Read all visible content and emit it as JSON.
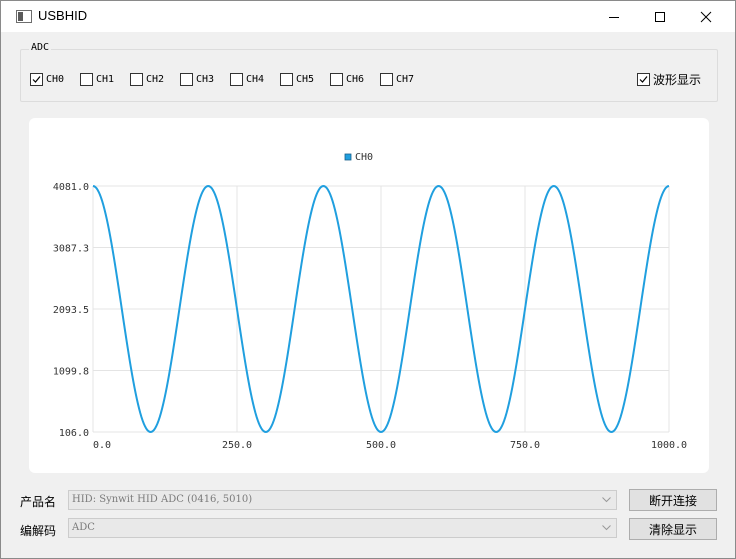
{
  "window": {
    "title": "USBHID"
  },
  "adc_group": {
    "label": "ADC",
    "channels": [
      {
        "label": "CH0",
        "checked": true
      },
      {
        "label": "CH1",
        "checked": false
      },
      {
        "label": "CH2",
        "checked": false
      },
      {
        "label": "CH3",
        "checked": false
      },
      {
        "label": "CH4",
        "checked": false
      },
      {
        "label": "CH5",
        "checked": false
      },
      {
        "label": "CH6",
        "checked": false
      },
      {
        "label": "CH7",
        "checked": false
      }
    ],
    "show_waveform": {
      "label": "波形显示",
      "checked": true
    }
  },
  "chart_data": {
    "type": "line",
    "title": "",
    "xlabel": "",
    "ylabel": "",
    "xlim": [
      0,
      1000
    ],
    "ylim": [
      106.0,
      4081.0
    ],
    "x_ticks": [
      "0.0",
      "250.0",
      "500.0",
      "750.0",
      "1000.0"
    ],
    "y_ticks": [
      "4081.0",
      "3087.3",
      "2093.5",
      "1099.8",
      "106.0"
    ],
    "grid": true,
    "legend_position": "top-center",
    "series": [
      {
        "name": "CH0",
        "color": "#209fdf",
        "description_period": 200,
        "x": [
          0,
          50,
          100,
          150,
          200,
          250,
          300,
          350,
          400,
          450,
          500,
          550,
          600,
          650,
          700,
          750,
          800,
          850,
          900,
          950,
          1000
        ],
        "y": [
          4081,
          2093.5,
          106,
          2093.5,
          4081,
          2093.5,
          106,
          2093.5,
          4081,
          2093.5,
          106,
          2093.5,
          4081,
          2093.5,
          106,
          2093.5,
          4081,
          2093.5,
          106,
          2093.5,
          4081
        ]
      }
    ]
  },
  "form": {
    "product_label": "产品名",
    "product_value": "HID: Synwit HID ADC (0416, 5010)",
    "decoder_label": "编解码",
    "decoder_value": "ADC",
    "disconnect_button": "断开连接",
    "clear_button": "清除显示"
  },
  "colors": {
    "series": "#209fdf",
    "grid": "#e4e4e4",
    "panel": "#ffffff"
  }
}
